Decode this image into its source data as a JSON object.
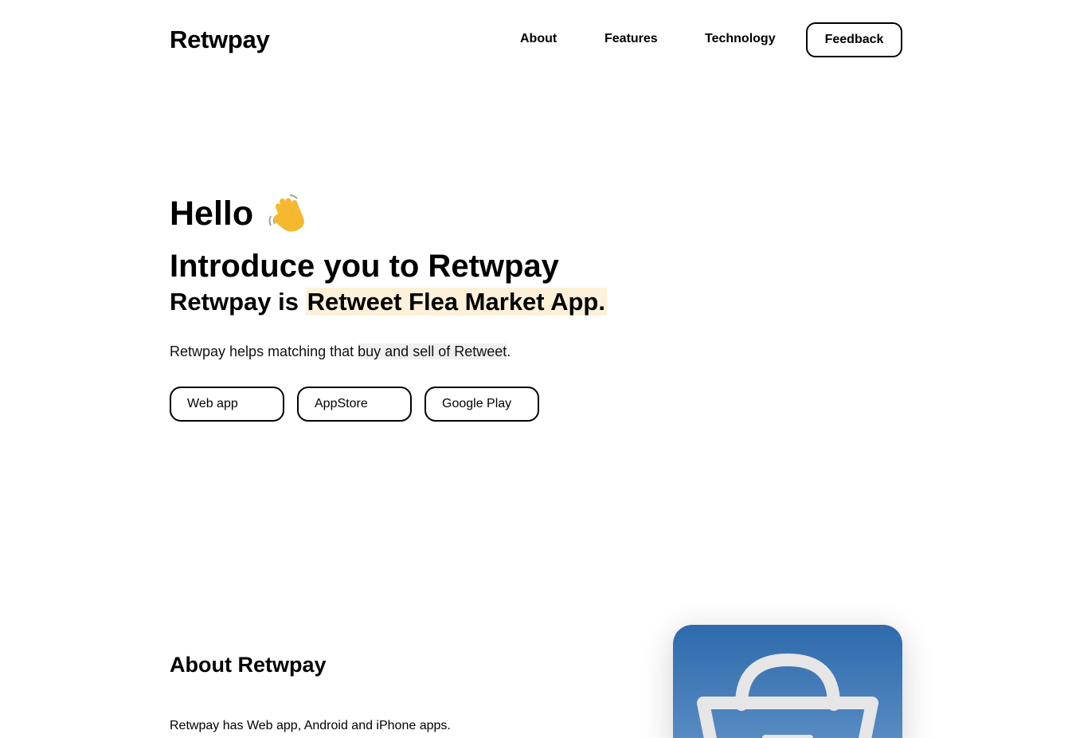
{
  "header": {
    "logo": "Retwpay",
    "nav": {
      "about": "About",
      "features": "Features",
      "technology": "Technology",
      "feedback": "Feedback"
    }
  },
  "hero": {
    "hello": "Hello",
    "wave_icon": "waving-hand-icon",
    "headline": "Introduce you to Retwpay",
    "subhead_prefix": "Retwpay is ",
    "subhead_highlight": "Retweet Flea Market App.",
    "desc_prefix": "Retwpay helps matching that ",
    "desc_highlight": "buy and sell of Retweet",
    "desc_suffix": ".",
    "buttons": {
      "web": "Web app",
      "appstore": "AppStore",
      "googleplay": "Google Play"
    }
  },
  "about": {
    "title": "About Retwpay",
    "text": "Retwpay has Web app, Android and iPhone apps.",
    "app_icon": "shopping-basket-icon"
  },
  "colors": {
    "highlight": "#fdf1d9",
    "icon_gradient_top": "#2e6aad",
    "icon_gradient_bottom": "#5c8fc4"
  }
}
